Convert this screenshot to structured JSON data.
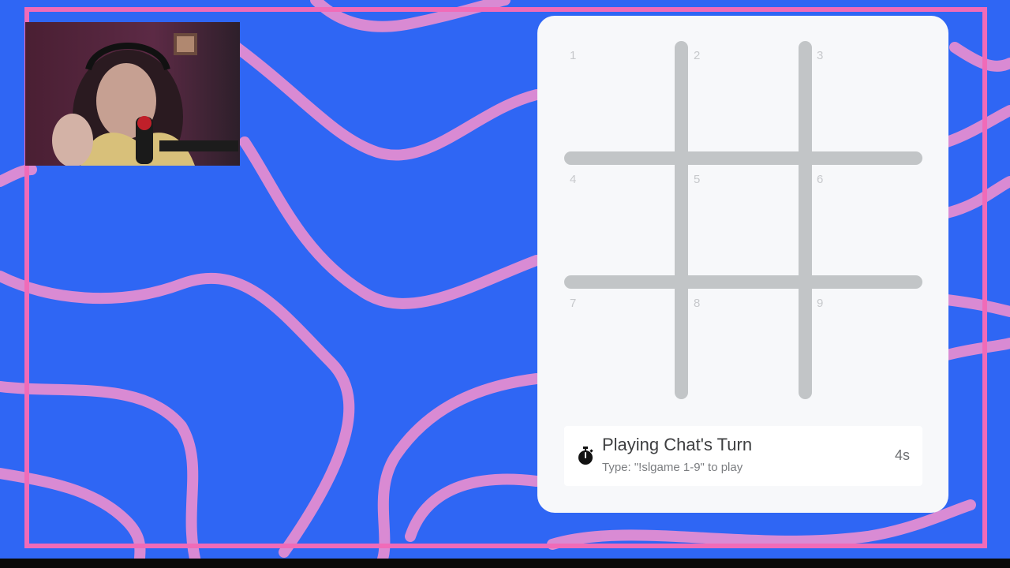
{
  "board": {
    "cells": [
      "1",
      "2",
      "3",
      "4",
      "5",
      "6",
      "7",
      "8",
      "9"
    ]
  },
  "status": {
    "icon": "stopwatch-icon",
    "title": "Playing Chat's Turn",
    "subtitle": "Type: \"!slgame 1-9\" to play",
    "timer": "4s"
  },
  "colors": {
    "background": "#2f66f4",
    "frame": "#f472b6",
    "card": "#f7f8fa",
    "grid_lines": "#c2c5c7"
  }
}
